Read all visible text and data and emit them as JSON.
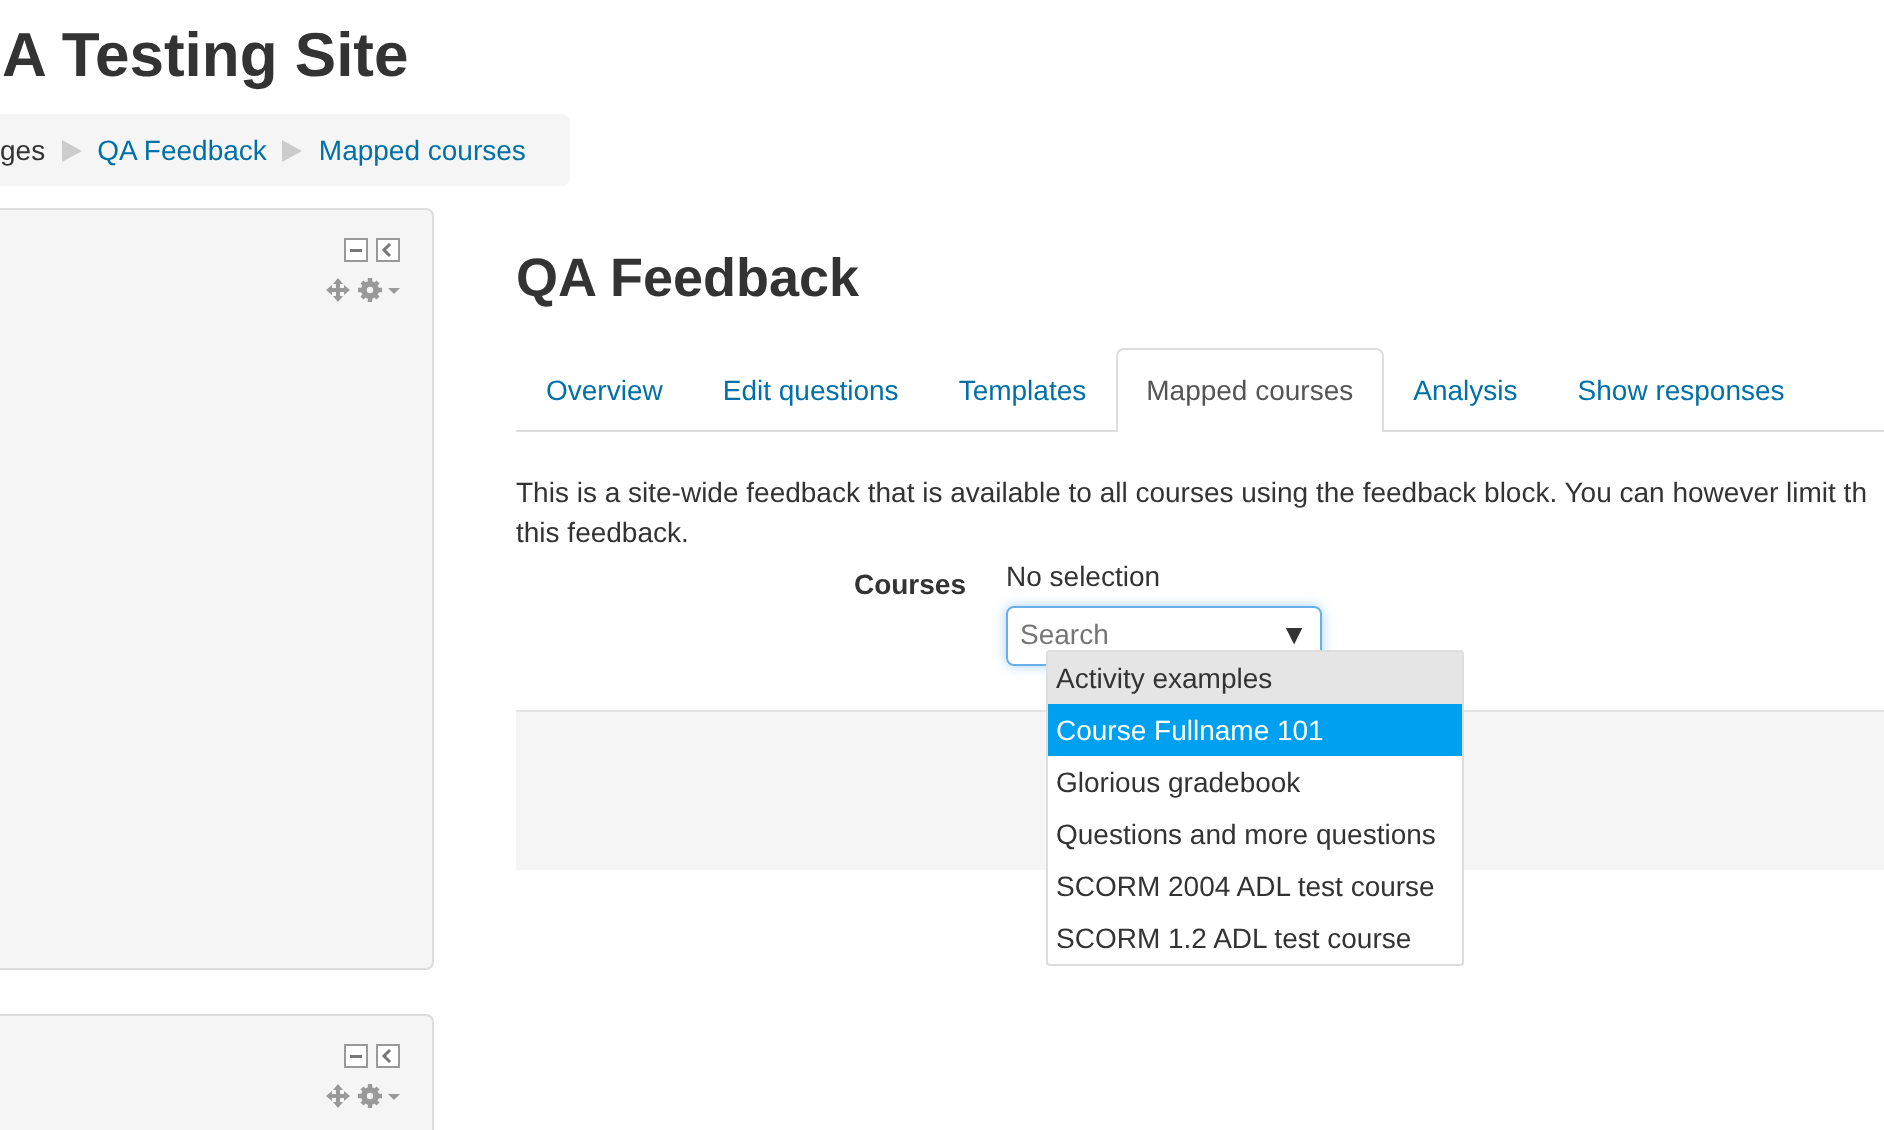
{
  "site_title": "A Testing Site",
  "breadcrumb": [
    {
      "label": "ges",
      "link": false
    },
    {
      "label": "QA Feedback",
      "link": true
    },
    {
      "label": "Mapped courses",
      "link": true
    }
  ],
  "blocks": [
    {
      "kind": "block"
    },
    {
      "kind": "block"
    }
  ],
  "heading": "QA Feedback",
  "tabs": [
    {
      "label": "Overview",
      "selected": false
    },
    {
      "label": "Edit questions",
      "selected": false
    },
    {
      "label": "Templates",
      "selected": false
    },
    {
      "label": "Mapped courses",
      "selected": true
    },
    {
      "label": "Analysis",
      "selected": false
    },
    {
      "label": "Show responses",
      "selected": false
    }
  ],
  "intro": "This is a site-wide feedback that is available to all courses using the feedback block. You can however limit th this feedback.",
  "courses_field": {
    "label": "Courses",
    "current": "No selection",
    "placeholder": "Search",
    "dropdown_arrow": "▼",
    "options": [
      {
        "label": "Activity examples",
        "selected": false,
        "highlighted": true
      },
      {
        "label": "Course Fullname 101",
        "selected": true,
        "highlighted": false
      },
      {
        "label": "Glorious gradebook",
        "selected": false,
        "highlighted": false
      },
      {
        "label": "Questions and more questions",
        "selected": false,
        "highlighted": false
      },
      {
        "label": "SCORM 2004 ADL test course",
        "selected": false,
        "highlighted": false
      },
      {
        "label": "SCORM 1.2 ADL test course",
        "selected": false,
        "highlighted": false
      }
    ]
  }
}
